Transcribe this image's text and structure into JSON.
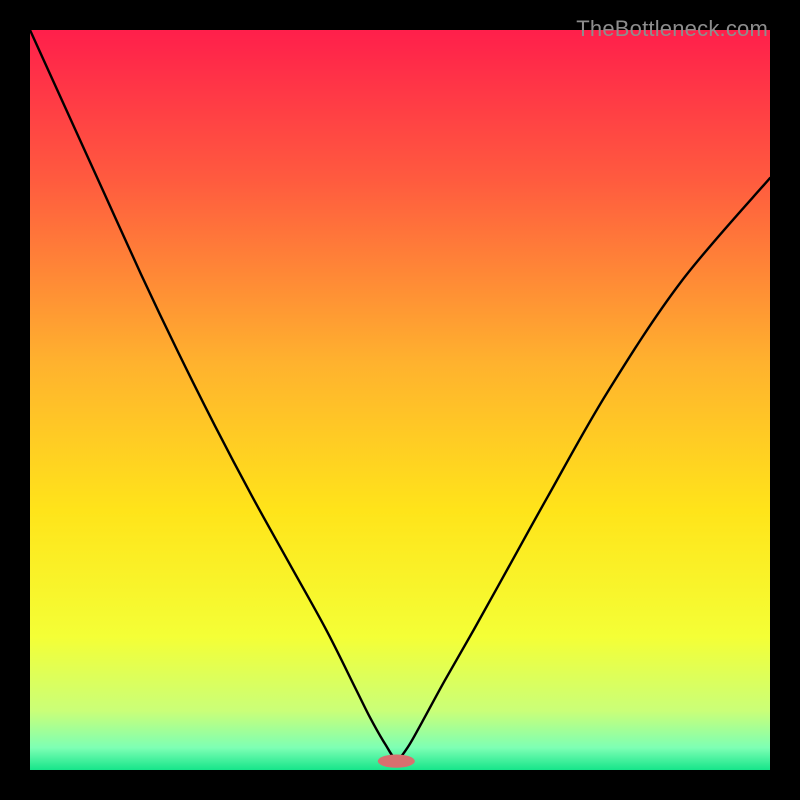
{
  "watermark": "TheBottleneck.com",
  "chart_data": {
    "type": "line",
    "title": "",
    "xlabel": "",
    "ylabel": "",
    "xlim": [
      0,
      100
    ],
    "ylim": [
      0,
      100
    ],
    "grid": false,
    "legend": false,
    "annotations": [],
    "background_gradient_stops": [
      {
        "offset": 0.0,
        "color": "#ff1f4b"
      },
      {
        "offset": 0.2,
        "color": "#ff5a3f"
      },
      {
        "offset": 0.45,
        "color": "#ffb22e"
      },
      {
        "offset": 0.65,
        "color": "#ffe41a"
      },
      {
        "offset": 0.82,
        "color": "#f4ff36"
      },
      {
        "offset": 0.92,
        "color": "#caff78"
      },
      {
        "offset": 0.97,
        "color": "#7dffb4"
      },
      {
        "offset": 1.0,
        "color": "#16e58a"
      }
    ],
    "series": [
      {
        "name": "bottleneck-curve",
        "stroke": "#000000",
        "stroke_width": 2.4,
        "x": [
          0,
          5,
          10,
          15,
          20,
          25,
          30,
          35,
          40,
          44,
          46,
          48,
          49.5,
          51,
          53,
          56,
          60,
          65,
          70,
          78,
          88,
          100
        ],
        "y": [
          100,
          89,
          78,
          67,
          56.5,
          46.5,
          37,
          28,
          19,
          11,
          7,
          3.5,
          1.5,
          3,
          6.5,
          12,
          19,
          28,
          37,
          51,
          66,
          80
        ]
      }
    ],
    "marker": {
      "name": "min-marker",
      "cx": 49.5,
      "cy": 1.2,
      "rx": 2.5,
      "ry": 0.9,
      "fill": "#d7706f"
    }
  }
}
